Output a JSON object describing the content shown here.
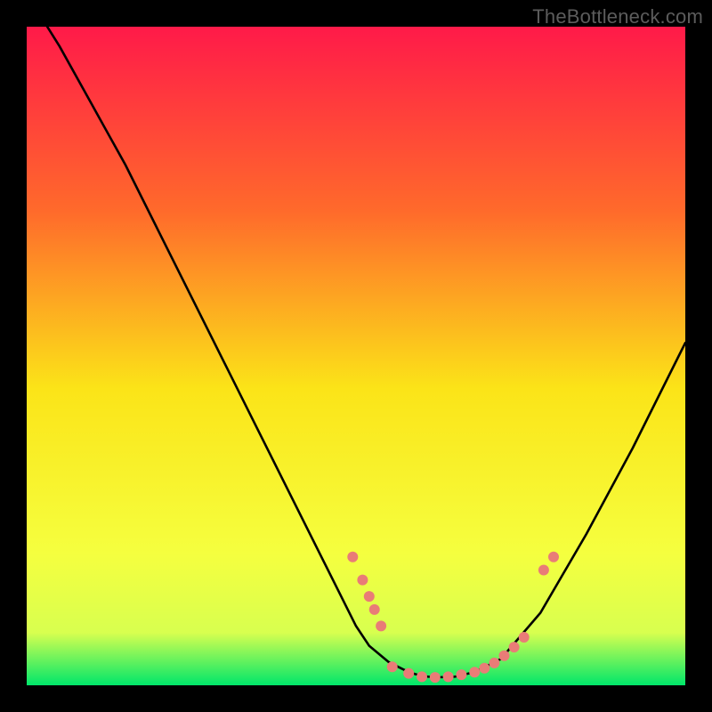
{
  "watermark": "TheBottleneck.com",
  "colors": {
    "bg": "#000000",
    "gradient_top": "#ff1a49",
    "gradient_upper_mid": "#ff6a2b",
    "gradient_mid": "#fbe418",
    "gradient_lower_mid": "#f5ff3f",
    "gradient_low": "#d8ff4f",
    "gradient_bottom": "#00e66a",
    "curve": "#000000",
    "dot": "#e97c77"
  },
  "chart_data": {
    "type": "line",
    "title": "",
    "xlabel": "",
    "ylabel": "",
    "xlim": [
      0,
      100
    ],
    "ylim": [
      0,
      100
    ],
    "grid": false,
    "legend": false,
    "series": [
      {
        "name": "bottleneck-curve",
        "x": [
          0,
          5,
          10,
          15,
          20,
          25,
          30,
          35,
          40,
          45,
          48,
          50,
          52,
          55,
          58,
          60,
          62,
          65,
          68,
          72,
          78,
          85,
          92,
          100
        ],
        "y": [
          105,
          97,
          88,
          79,
          69,
          59,
          49,
          39,
          29,
          19,
          13,
          9,
          6,
          3.5,
          2,
          1.4,
          1.2,
          1.3,
          2,
          4,
          11,
          23,
          36,
          52
        ]
      }
    ],
    "points": [
      {
        "x": 49.5,
        "y": 19.5
      },
      {
        "x": 51.0,
        "y": 16.0
      },
      {
        "x": 52.0,
        "y": 13.5
      },
      {
        "x": 52.8,
        "y": 11.5
      },
      {
        "x": 53.8,
        "y": 9.0
      },
      {
        "x": 55.5,
        "y": 2.8
      },
      {
        "x": 58.0,
        "y": 1.8
      },
      {
        "x": 60.0,
        "y": 1.3
      },
      {
        "x": 62.0,
        "y": 1.2
      },
      {
        "x": 64.0,
        "y": 1.3
      },
      {
        "x": 66.0,
        "y": 1.6
      },
      {
        "x": 68.0,
        "y": 2.0
      },
      {
        "x": 69.5,
        "y": 2.6
      },
      {
        "x": 71.0,
        "y": 3.4
      },
      {
        "x": 72.5,
        "y": 4.5
      },
      {
        "x": 74.0,
        "y": 5.8
      },
      {
        "x": 75.5,
        "y": 7.3
      },
      {
        "x": 78.5,
        "y": 17.5
      },
      {
        "x": 80.0,
        "y": 19.5
      }
    ]
  }
}
